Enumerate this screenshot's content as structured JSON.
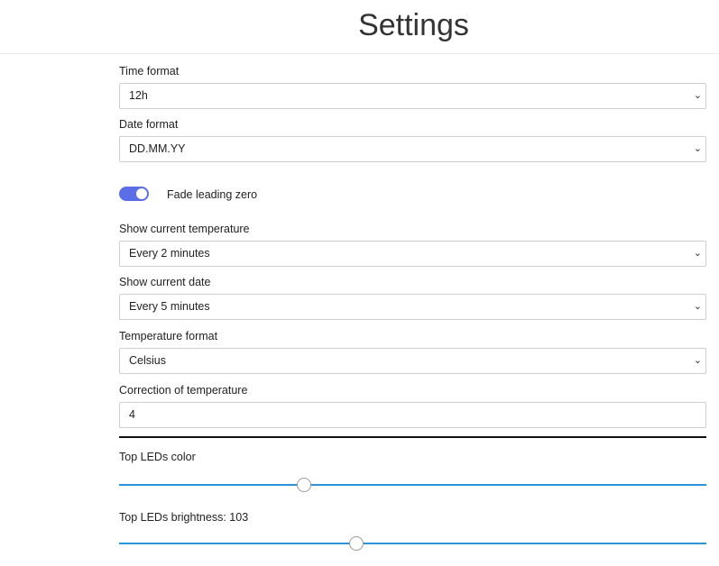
{
  "header": {
    "title": "Settings"
  },
  "time_format": {
    "label": "Time format",
    "value": "12h"
  },
  "date_format": {
    "label": "Date format",
    "value": "DD.MM.YY"
  },
  "fade_toggle": {
    "label": "Fade leading zero",
    "on": true
  },
  "show_temp": {
    "label": "Show current temperature",
    "value": "Every 2 minutes"
  },
  "show_date": {
    "label": "Show current date",
    "value": "Every 5 minutes"
  },
  "temp_format": {
    "label": "Temperature format",
    "value": "Celsius"
  },
  "temp_correction": {
    "label": "Correction of temperature",
    "value": "4"
  },
  "top_leds_color": {
    "label": "Top LEDs color",
    "level": 0.315
  },
  "top_leds_brightness": {
    "label": "Top LEDs brightness: 103",
    "value": 103,
    "min": 0,
    "max": 255
  },
  "icons": {
    "select_chevron": "chevron-down-icon"
  },
  "colors": {
    "accent": "#5b6ee8",
    "slider": "#2b94d8"
  }
}
